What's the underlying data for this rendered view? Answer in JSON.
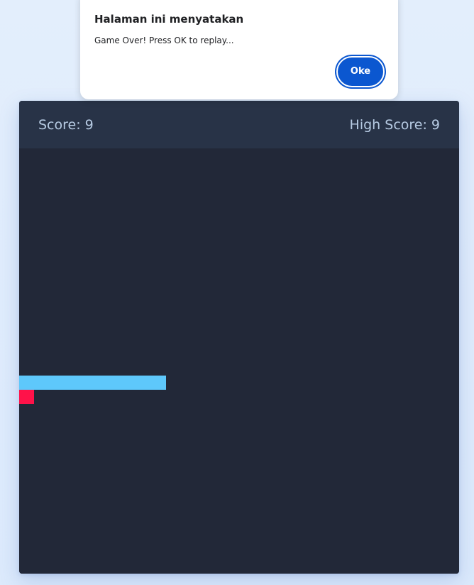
{
  "game": {
    "score_text": "Score: 9",
    "high_score_text": "High Score: 9",
    "score": 9,
    "high_score": 9,
    "colors": {
      "board": "#222838",
      "scorebar": "#283347",
      "score_text": "#b7cbe3",
      "snake": "#5ec8fb",
      "food": "#ff1249"
    }
  },
  "dialog": {
    "title": "Halaman ini menyatakan",
    "message": "Game Over! Press OK to replay...",
    "ok_label": "Oke",
    "accent": "#0b57d0"
  }
}
